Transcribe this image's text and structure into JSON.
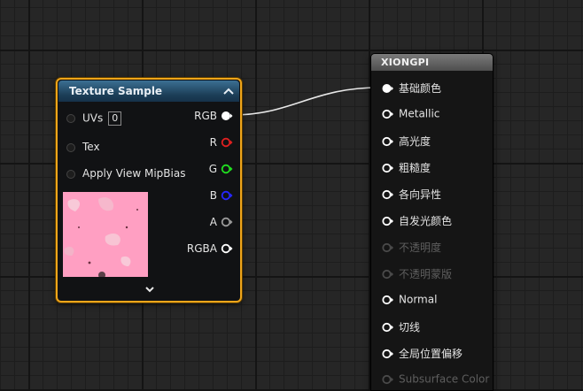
{
  "texture_node": {
    "title": "Texture Sample",
    "inputs": [
      {
        "label": "UVs",
        "value": "0"
      },
      {
        "label": "Tex"
      },
      {
        "label": "Apply View MipBias"
      }
    ],
    "outputs": [
      {
        "label": "RGB",
        "color": "#ffffff",
        "connected": true
      },
      {
        "label": "R",
        "color": "#e02020",
        "connected": false
      },
      {
        "label": "G",
        "color": "#20e020",
        "connected": false
      },
      {
        "label": "B",
        "color": "#2020e0",
        "connected": false
      },
      {
        "label": "A",
        "color": "#9a9a9a",
        "connected": false
      },
      {
        "label": "RGBA",
        "color": "#ffffff",
        "connected": false
      }
    ],
    "selection_color": "#f0a61a",
    "header_color": "#2a5576"
  },
  "material_node": {
    "title": "XIONGPI",
    "pins": [
      {
        "label": "基础颜色",
        "enabled": true,
        "connected": true
      },
      {
        "label": "Metallic",
        "enabled": true,
        "connected": false
      },
      {
        "label": "高光度",
        "enabled": true,
        "connected": false
      },
      {
        "label": "粗糙度",
        "enabled": true,
        "connected": false
      },
      {
        "label": "各向异性",
        "enabled": true,
        "connected": false
      },
      {
        "label": "自发光颜色",
        "enabled": true,
        "connected": false
      },
      {
        "label": "不透明度",
        "enabled": false,
        "connected": false
      },
      {
        "label": "不透明蒙版",
        "enabled": false,
        "connected": false
      },
      {
        "label": "Normal",
        "enabled": true,
        "connected": false
      },
      {
        "label": "切线",
        "enabled": true,
        "connected": false
      },
      {
        "label": "全局位置偏移",
        "enabled": true,
        "connected": false
      },
      {
        "label": "Subsurface Color",
        "enabled": false,
        "connected": false
      }
    ]
  }
}
